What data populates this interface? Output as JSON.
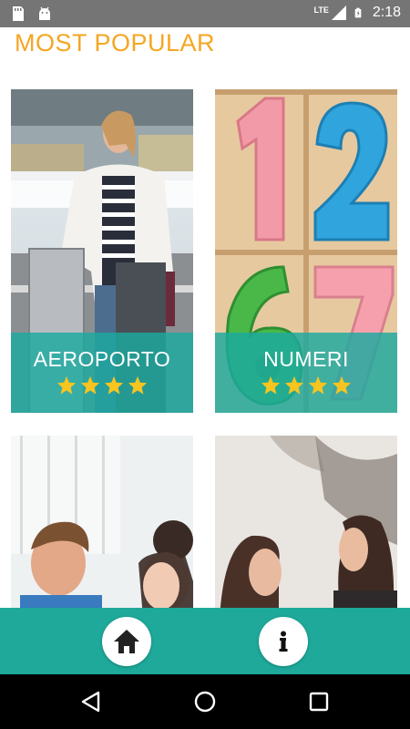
{
  "status_bar": {
    "time": "2:18",
    "network": "LTE",
    "icons": [
      "sd-card-icon",
      "android-icon",
      "signal-icon",
      "battery-charging-icon"
    ]
  },
  "page": {
    "title": "MOST POPULAR"
  },
  "cards": [
    {
      "label": "AEROPORTO",
      "stars": 4,
      "photo": "woman-with-luggage-at-airport"
    },
    {
      "label": "NUMERI",
      "stars": 4,
      "photo": "colored-foam-numbers-1-2-6-7"
    },
    {
      "label": "",
      "stars": 0,
      "photo": "smiling-man-and-woman"
    },
    {
      "label": "",
      "stars": 0,
      "photo": "two-women-laughing-outdoors"
    }
  ],
  "bottom_bar": {
    "buttons": [
      "home-icon",
      "info-icon"
    ]
  },
  "nav_bar": {
    "buttons": [
      "back-icon",
      "home-circle-icon",
      "recents-icon"
    ]
  },
  "colors": {
    "accent": "#f5a623",
    "teal": "#1ea99a",
    "status_bar": "#757575",
    "star": "#f7c520"
  }
}
